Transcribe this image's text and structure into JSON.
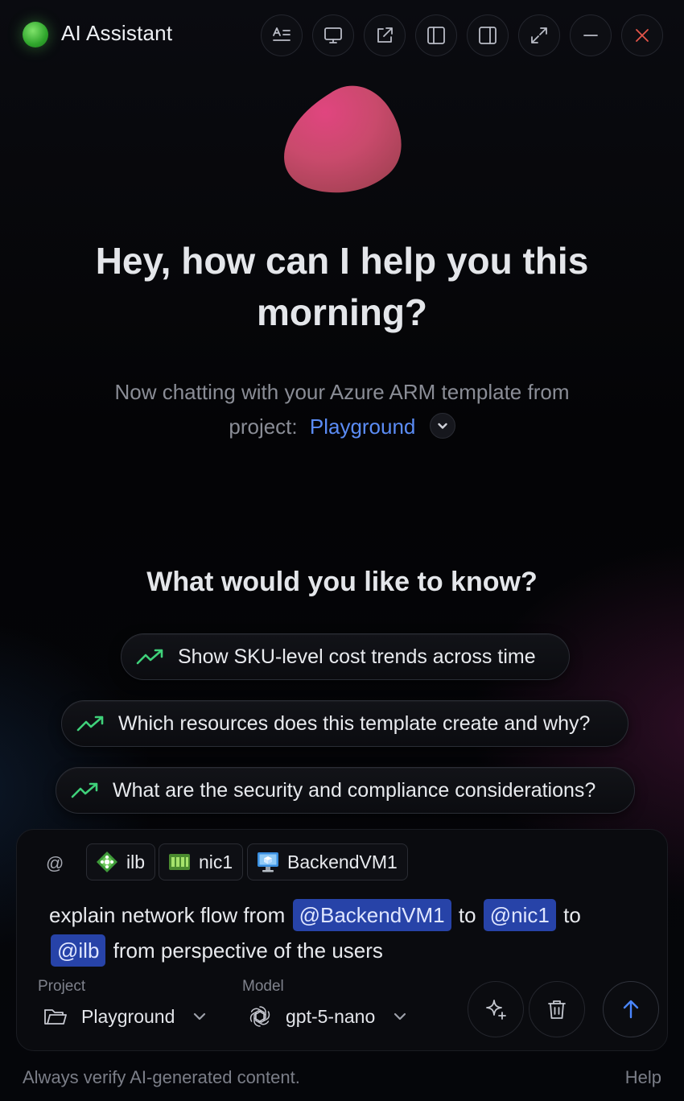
{
  "window": {
    "title": "AI Assistant",
    "status_color": "#3fb53a",
    "toolbar": [
      {
        "name": "text-format-icon"
      },
      {
        "name": "desktop-icon"
      },
      {
        "name": "external-link-icon"
      },
      {
        "name": "sidebar-left-icon"
      },
      {
        "name": "sidebar-right-icon"
      },
      {
        "name": "expand-icon"
      },
      {
        "name": "minimize-icon"
      },
      {
        "name": "close-icon"
      }
    ]
  },
  "hero": {
    "heading_line1": "Hey, how can I help you this",
    "heading_line2": "morning?",
    "subtitle_line1": "Now chatting with your Azure ARM template from",
    "subtitle_prefix": "project:",
    "project_name": "Playground"
  },
  "suggestions": {
    "title": "What would you like to know?",
    "items": [
      {
        "label": "Show SKU-level cost trends across time",
        "icon": "trending-up-icon"
      },
      {
        "label": "Which resources does this template create and why?",
        "icon": "trending-up-icon"
      },
      {
        "label": "What are the security and compliance considerations?",
        "icon": "trending-up-icon"
      }
    ]
  },
  "composer": {
    "at_symbol": "@",
    "context_chips": [
      {
        "label": "ilb",
        "icon": "load-balancer-icon"
      },
      {
        "label": "nic1",
        "icon": "network-interface-icon"
      },
      {
        "label": "BackendVM1",
        "icon": "virtual-machine-icon"
      }
    ],
    "message": {
      "part1": "explain network flow from",
      "mention1": "@BackendVM1",
      "part2": "to",
      "mention2": "@nic1",
      "part3": "to",
      "mention3": "@ilb",
      "part4": "from perspective of the users"
    },
    "project_label": "Project",
    "project_value": "Playground",
    "model_label": "Model",
    "model_value": "gpt-5-nano",
    "send_color": "#4a86ff"
  },
  "footer": {
    "note": "Always verify AI-generated content.",
    "help": "Help"
  }
}
